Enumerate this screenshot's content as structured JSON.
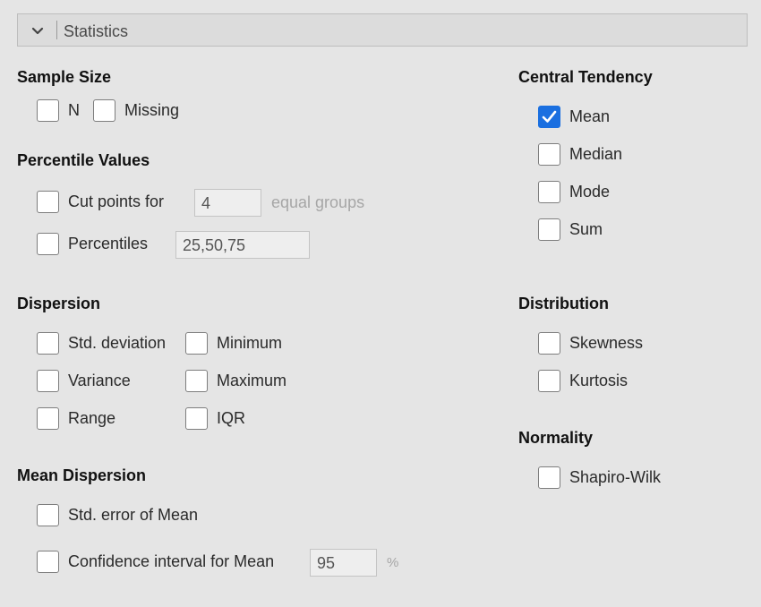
{
  "header": {
    "title": "Statistics",
    "toggle_icon": "chevron-down-icon"
  },
  "sample_size": {
    "title": "Sample Size",
    "n": {
      "label": "N",
      "checked": false
    },
    "missing": {
      "label": "Missing",
      "checked": false
    }
  },
  "percentile_values": {
    "title": "Percentile Values",
    "cut_points": {
      "label": "Cut points for",
      "value": "4",
      "suffix": "equal groups",
      "checked": false
    },
    "percentiles": {
      "label": "Percentiles",
      "value": "25,50,75",
      "checked": false
    }
  },
  "central_tendency": {
    "title": "Central Tendency",
    "mean": {
      "label": "Mean",
      "checked": true
    },
    "median": {
      "label": "Median",
      "checked": false
    },
    "mode": {
      "label": "Mode",
      "checked": false
    },
    "sum": {
      "label": "Sum",
      "checked": false
    }
  },
  "dispersion": {
    "title": "Dispersion",
    "std_deviation": {
      "label": "Std. deviation",
      "checked": false
    },
    "variance": {
      "label": "Variance",
      "checked": false
    },
    "range": {
      "label": "Range",
      "checked": false
    },
    "minimum": {
      "label": "Minimum",
      "checked": false
    },
    "maximum": {
      "label": "Maximum",
      "checked": false
    },
    "iqr": {
      "label": "IQR",
      "checked": false
    }
  },
  "distribution": {
    "title": "Distribution",
    "skewness": {
      "label": "Skewness",
      "checked": false
    },
    "kurtosis": {
      "label": "Kurtosis",
      "checked": false
    }
  },
  "normality": {
    "title": "Normality",
    "shapiro_wilk": {
      "label": "Shapiro-Wilk",
      "checked": false
    }
  },
  "mean_dispersion": {
    "title": "Mean Dispersion",
    "std_error": {
      "label": "Std. error of Mean",
      "checked": false
    },
    "confidence_interval": {
      "label": "Confidence interval for Mean",
      "value": "95",
      "suffix": "%",
      "checked": false
    }
  },
  "colors": {
    "checkbox_checked": "#1a6fe0",
    "background": "#e5e5e5"
  }
}
